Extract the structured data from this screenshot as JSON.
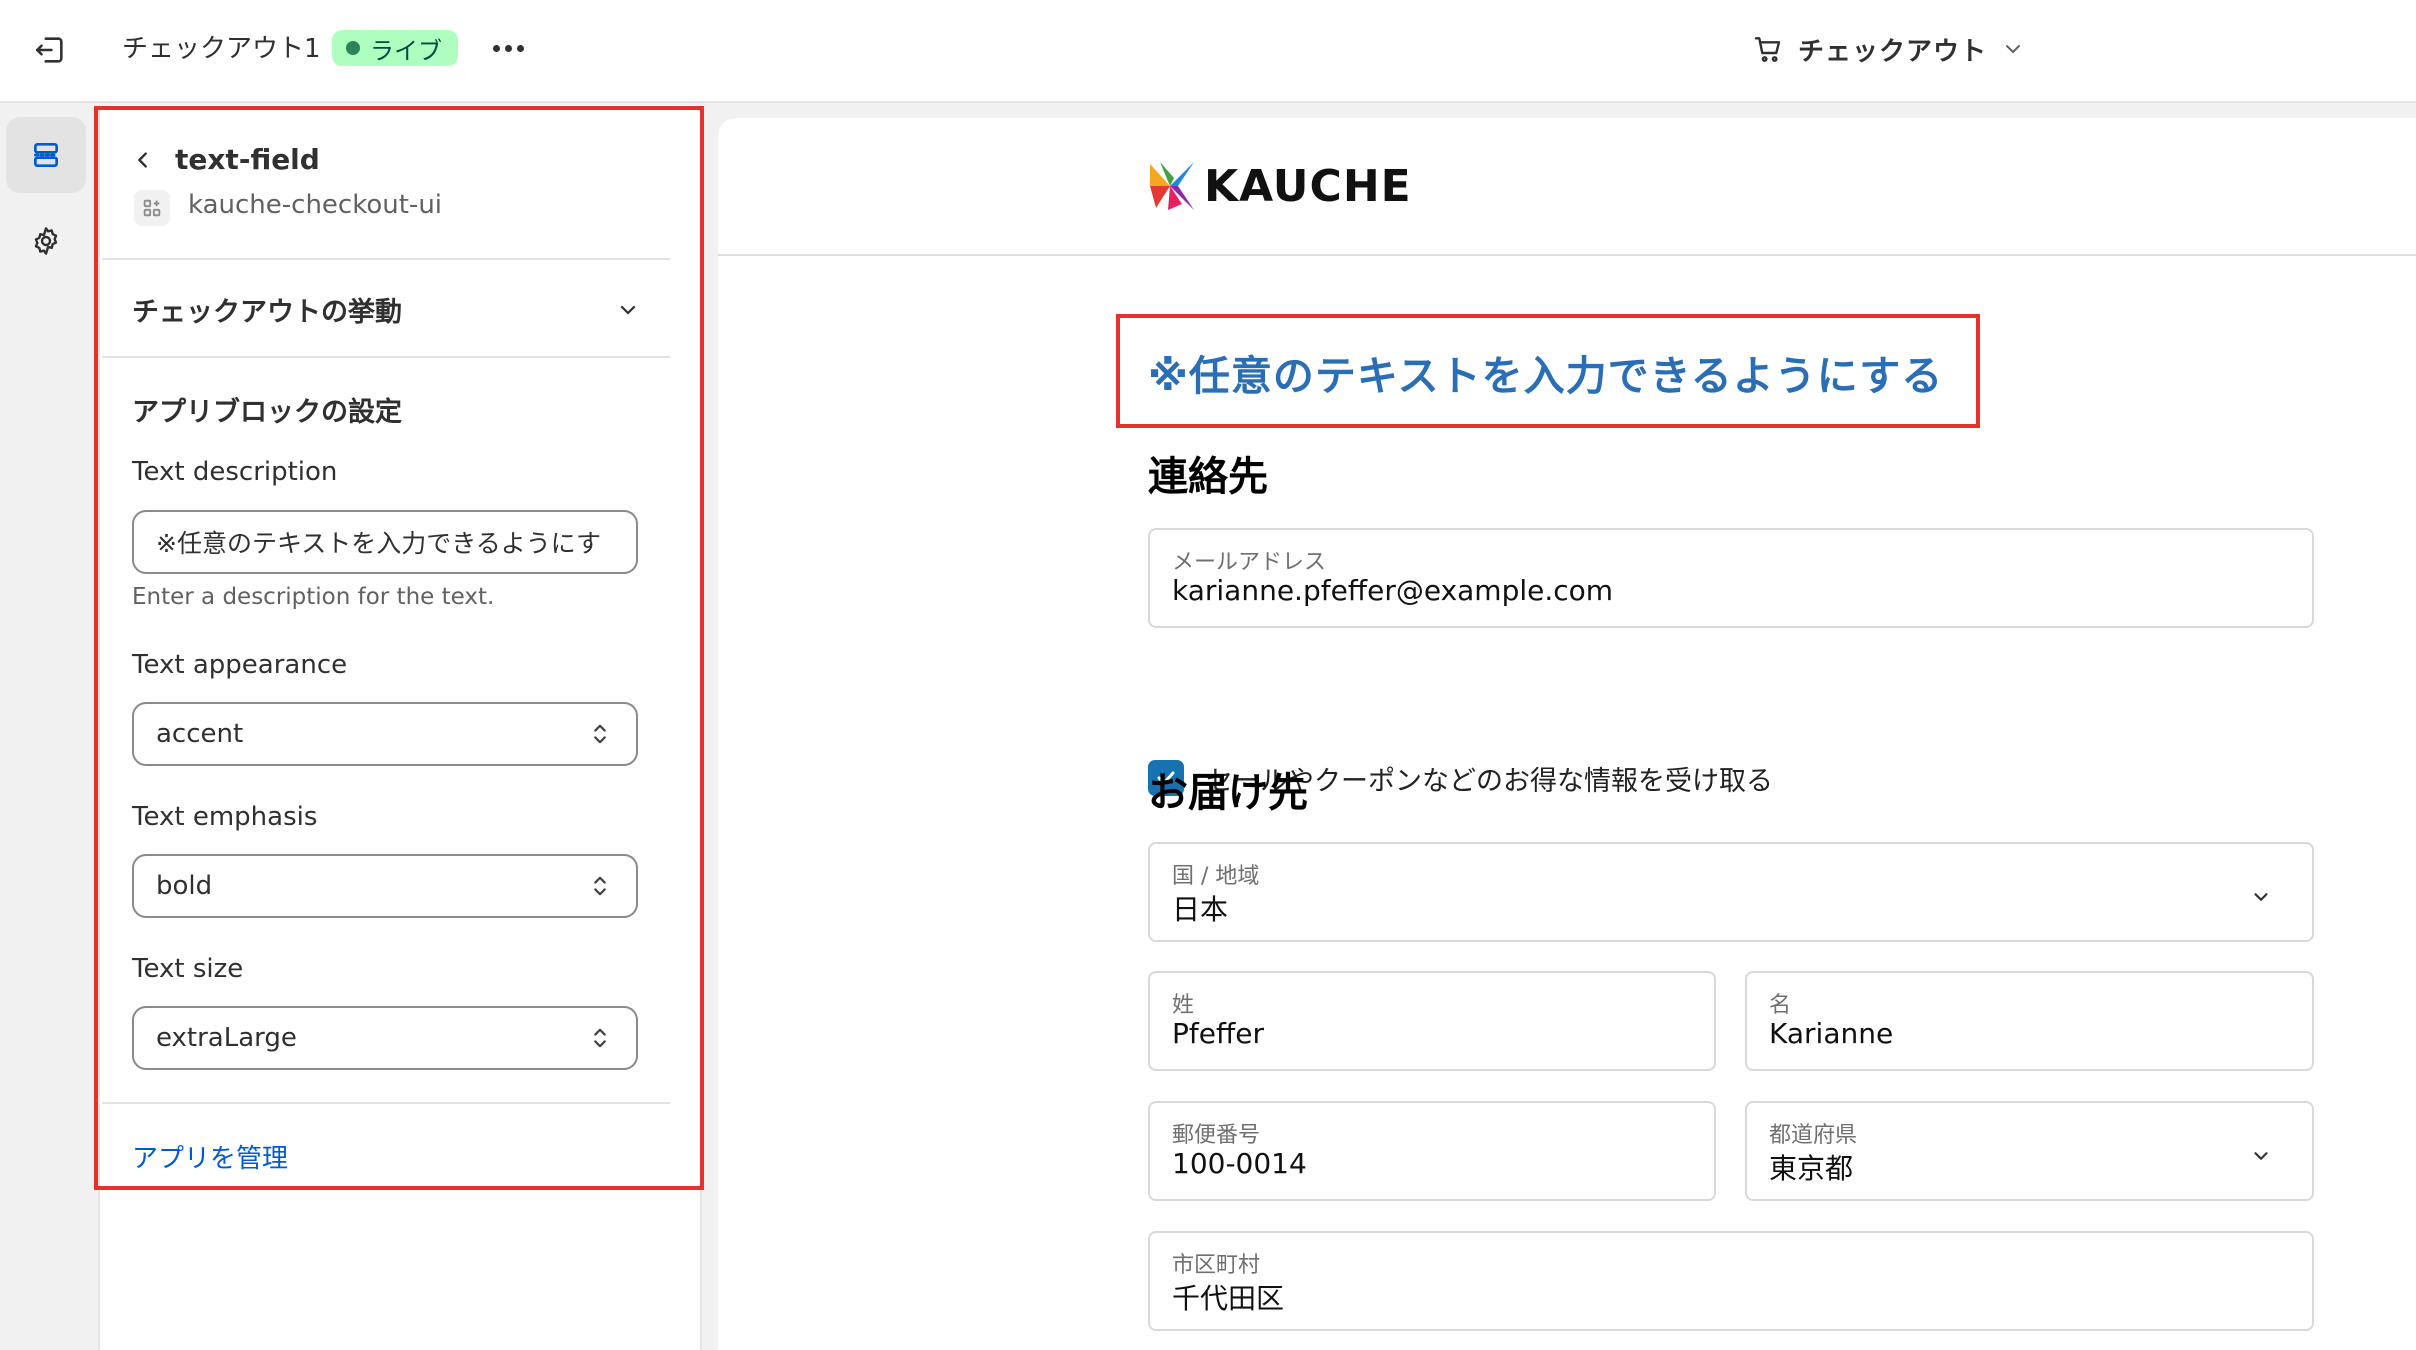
{
  "topbar": {
    "app_title": "チェックアウト1",
    "status_badge": "ライブ",
    "page_selector_label": "チェックアウト"
  },
  "panel": {
    "block_title": "text-field",
    "extension_name": "kauche-checkout-ui",
    "section_collapsed": "チェックアウトの挙動",
    "app_block_heading": "アプリブロックの設定",
    "text_description_label": "Text description",
    "text_description_value": "※任意のテキストを入力できるようにす",
    "text_description_help": "Enter a description for the text.",
    "text_appearance_label": "Text appearance",
    "text_appearance_value": "accent",
    "text_emphasis_label": "Text emphasis",
    "text_emphasis_value": "bold",
    "text_size_label": "Text size",
    "text_size_value": "extraLarge",
    "manage_app_link": "アプリを管理"
  },
  "preview": {
    "brand": "KAUCHE",
    "custom_text": "※任意のテキストを入力できるようにする",
    "contact_heading": "連絡先",
    "email_label": "メールアドレス",
    "email_value": "karianne.pfeffer@example.com",
    "newsletter_label": "セールやクーポンなどのお得な情報を受け取る",
    "newsletter_checked": true,
    "delivery_heading": "お届け先",
    "country_label": "国 / 地域",
    "country_value": "日本",
    "last_name_label": "姓",
    "last_name_value": "Pfeffer",
    "first_name_label": "名",
    "first_name_value": "Karianne",
    "postal_label": "郵便番号",
    "postal_value": "100-0014",
    "prefecture_label": "都道府県",
    "prefecture_value": "東京都",
    "city_label": "市区町村",
    "city_value": "千代田区"
  },
  "colors": {
    "accent_text": "#2a6fb5",
    "highlight_border": "#e5322d",
    "badge_bg": "#affebf",
    "checkbox": "#1773b0",
    "link": "#005bd3"
  }
}
